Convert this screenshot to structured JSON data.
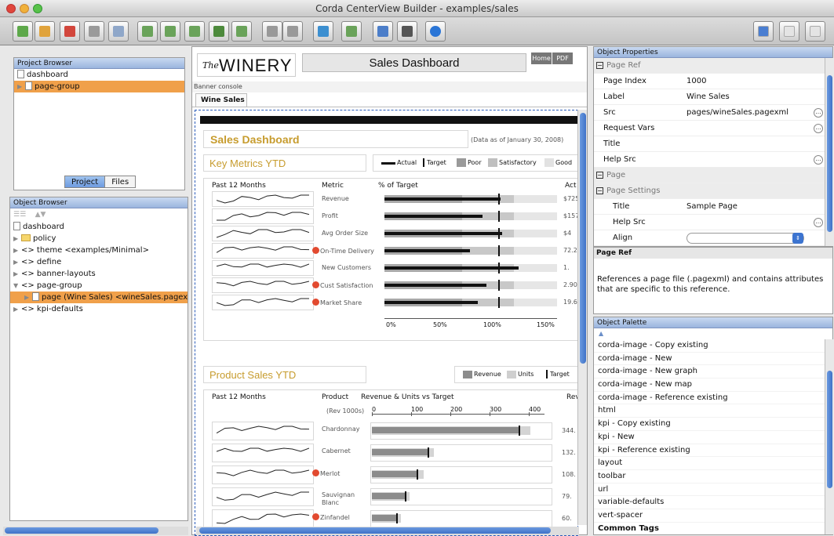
{
  "window": {
    "title": "Corda CenterView Builder - examples/sales"
  },
  "colors": {
    "accent": "#f0a04a",
    "brand_gold": "#c79c2e",
    "marker_red": "#e24a30",
    "panel_header": "#9ab5de",
    "bar_actual": "#111111"
  },
  "toolbar": {
    "icons": [
      "add-icon",
      "home-icon",
      "delete-icon",
      "save-icon",
      "preview-icon",
      "new-page-icon",
      "copy-icon",
      "table-icon",
      "filter-icon",
      "image-icon",
      "undo-icon",
      "redo-icon",
      "refresh-icon",
      "page-icon",
      "layout-icon",
      "export-icon",
      "help-icon"
    ],
    "right_icons": [
      "grid-view-icon",
      "chart-view-icon",
      "code-view-icon"
    ]
  },
  "project_browser": {
    "title": "Project Browser",
    "items": [
      "dashboard",
      "page-group"
    ],
    "tabs": [
      "Project",
      "Files"
    ]
  },
  "object_browser": {
    "title": "Object Browser",
    "items": [
      {
        "label": "dashboard",
        "indent": 0
      },
      {
        "label": "policy",
        "indent": 0
      },
      {
        "label": "<> theme   <examples/Minimal>",
        "indent": 0
      },
      {
        "label": "<> define",
        "indent": 0
      },
      {
        "label": "<> banner-layouts",
        "indent": 0
      },
      {
        "label": "<> page-group",
        "indent": 0
      },
      {
        "label": "page (Wine Sales)   <wineSales.pagexm",
        "indent": 1
      },
      {
        "label": "<> kpi-defaults",
        "indent": 0
      }
    ]
  },
  "canvas": {
    "logo": "WINERY",
    "logo_prefix": "The",
    "header_title": "Sales Dashboard",
    "home_btn": "Home",
    "pdf_btn": "PDF",
    "banner_console": "Banner console",
    "tab": "Wine Sales",
    "dash_title": "Sales Dashboard",
    "data_as_of": "(Data as of January 30, 2008)",
    "kpi": {
      "title": "Key Metrics YTD",
      "legend": [
        "Actual",
        "Target",
        "Poor",
        "Satisfactory",
        "Good"
      ],
      "col_headers": [
        "Past 12 Months",
        "Metric",
        "% of Target",
        "Act"
      ],
      "rows": [
        {
          "metric": "Revenue",
          "flag": false,
          "value": "$725.",
          "actual_pct": 71,
          "poor_pct": 45,
          "sat_pct": 75
        },
        {
          "metric": "Profit",
          "flag": false,
          "value": "$157.",
          "actual_pct": 60,
          "poor_pct": 45,
          "sat_pct": 75
        },
        {
          "metric": "Avg Order Size",
          "flag": false,
          "value": "$4",
          "actual_pct": 72,
          "poor_pct": 45,
          "sat_pct": 75
        },
        {
          "metric": "On-Time Delivery",
          "flag": true,
          "value": "72.2",
          "actual_pct": 52,
          "poor_pct": 45,
          "sat_pct": 75
        },
        {
          "metric": "New Customers",
          "flag": false,
          "value": "1.",
          "actual_pct": 82,
          "poor_pct": 45,
          "sat_pct": 75
        },
        {
          "metric": "Cust Satisfaction",
          "flag": true,
          "value": "2.90",
          "actual_pct": 62,
          "poor_pct": 45,
          "sat_pct": 75
        },
        {
          "metric": "Market Share",
          "flag": true,
          "value": "19.6",
          "actual_pct": 57,
          "poor_pct": 45,
          "sat_pct": 75
        }
      ],
      "axis": [
        "0%",
        "50%",
        "100%",
        "150%"
      ]
    },
    "product": {
      "title": "Product Sales YTD",
      "legend": [
        "Revenue",
        "Units",
        "Target"
      ],
      "col_headers": [
        "Past 12 Months",
        "Product",
        "Revenue & Units vs Target",
        "Reven"
      ],
      "units_note": "(Rev 1000s)",
      "axis": [
        "0",
        "100",
        "200",
        "300",
        "400"
      ],
      "rows": [
        {
          "product": "Chardonnay",
          "flag": false,
          "value": "344.",
          "rev_pct": 86,
          "units_pct": 92
        },
        {
          "product": "Cabernet",
          "flag": false,
          "value": "132.",
          "rev_pct": 33,
          "units_pct": 36
        },
        {
          "product": "Merlot",
          "flag": true,
          "value": "108.",
          "rev_pct": 27,
          "units_pct": 30
        },
        {
          "product": "Sauvignan Blanc",
          "flag": false,
          "value": "79.",
          "rev_pct": 20,
          "units_pct": 22
        },
        {
          "product": "Zinfandel",
          "flag": true,
          "value": "60.",
          "rev_pct": 15,
          "units_pct": 17
        }
      ]
    }
  },
  "properties": {
    "title": "Object Properties",
    "rows": [
      {
        "type": "group",
        "label": "Page Ref"
      },
      {
        "type": "prop",
        "label": "Page Index",
        "value": "1000"
      },
      {
        "type": "prop",
        "label": "Label",
        "value": "Wine Sales"
      },
      {
        "type": "prop",
        "label": "Src",
        "value": "pages/wineSales.pagexml",
        "btn": true
      },
      {
        "type": "prop",
        "label": "Request Vars",
        "value": "",
        "btn": true
      },
      {
        "type": "prop",
        "label": "Title",
        "value": ""
      },
      {
        "type": "prop",
        "label": "Help Src",
        "value": "",
        "btn": true
      },
      {
        "type": "group",
        "label": "Page"
      },
      {
        "type": "group",
        "label": "Page Settings"
      },
      {
        "type": "subprop",
        "label": "Title",
        "value": "Sample Page"
      },
      {
        "type": "subprop",
        "label": "Help Src",
        "value": "",
        "btn": true
      },
      {
        "type": "subprop",
        "label": "Align",
        "value": "",
        "select": true
      }
    ],
    "desc_title": "Page Ref",
    "desc_text": "References a page file (.pagexml) and contains attributes that are specific to this reference."
  },
  "palette": {
    "title": "Object Palette",
    "items": [
      "corda-image - Copy existing",
      "corda-image - New",
      "corda-image - New graph",
      "corda-image - New map",
      "corda-image - Reference existing",
      "html",
      "kpi - Copy existing",
      "kpi - New",
      "kpi - Reference existing",
      "layout",
      "toolbar",
      "url",
      "variable-defaults",
      "vert-spacer",
      "Common Tags"
    ]
  }
}
